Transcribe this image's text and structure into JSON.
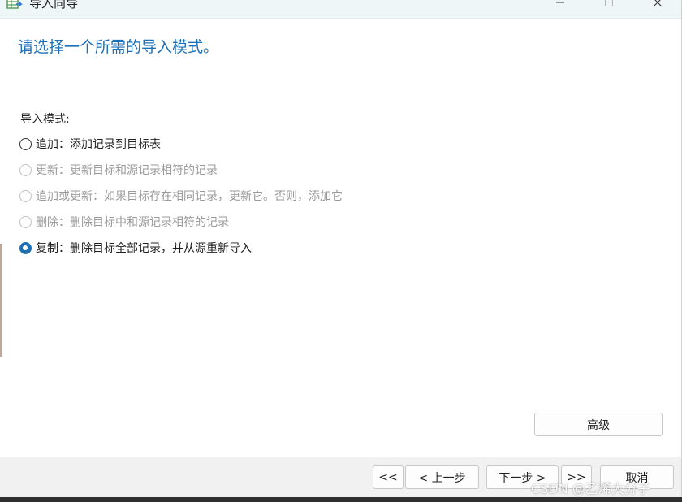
{
  "window": {
    "title": "导入向导",
    "icon": "import-wizard-icon",
    "controls": [
      "minimize-icon",
      "maximize-icon",
      "close-icon"
    ]
  },
  "heading": "请选择一个所需的导入模式。",
  "group_label": "导入模式:",
  "options": [
    {
      "label": "追加：添加记录到目标表",
      "enabled": true,
      "checked": false
    },
    {
      "label": "更新：更新目标和源记录相符的记录",
      "enabled": false,
      "checked": false
    },
    {
      "label": "追加或更新：如果目标存在相同记录，更新它。否则，添加它",
      "enabled": false,
      "checked": false
    },
    {
      "label": "删除：删除目标中和源记录相符的记录",
      "enabled": false,
      "checked": false
    },
    {
      "label": "复制：删除目标全部记录，并从源重新导入",
      "enabled": true,
      "checked": true
    }
  ],
  "buttons": {
    "advanced": "高级",
    "first": "<<",
    "prev": "< 上一步",
    "next": "下一步 >",
    "last": ">>",
    "cancel": "取消"
  },
  "watermark": "CSDN @乙烯大分子",
  "colors": {
    "accent": "#1f6fb5",
    "heading": "#1c6fb8",
    "titlebar": "#eef6f8",
    "footer": "#f1f1f1",
    "disabled_text": "#9a9a9a"
  }
}
